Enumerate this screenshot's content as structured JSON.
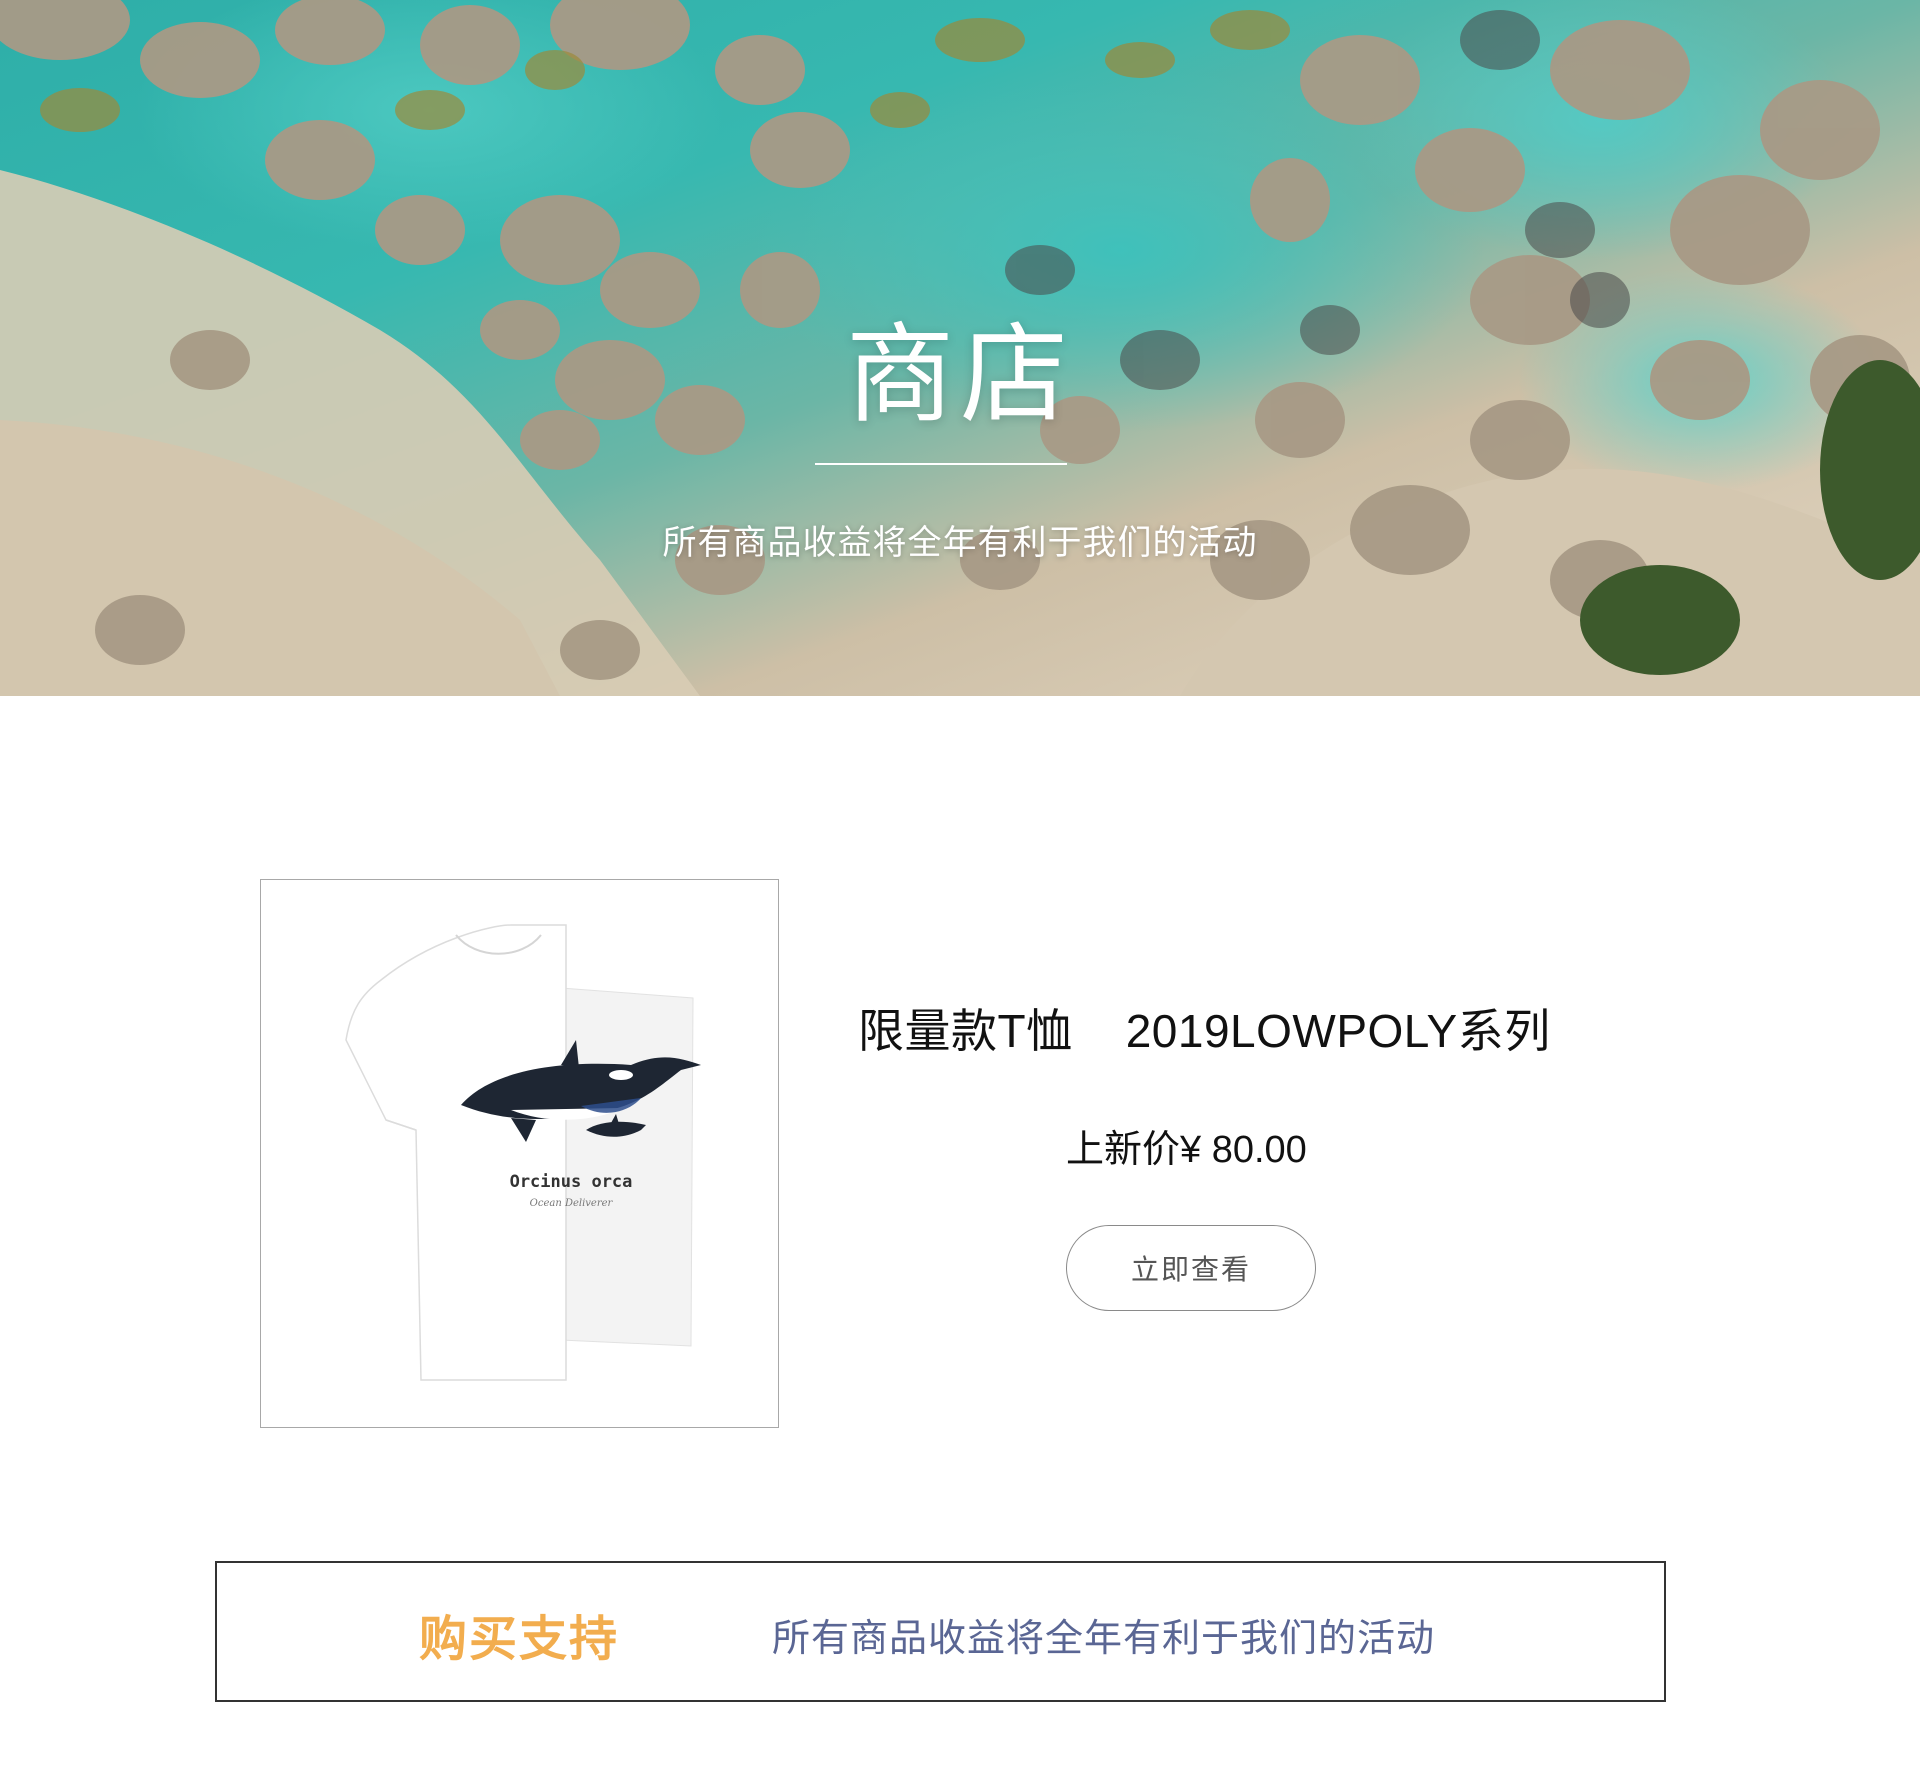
{
  "hero": {
    "title": "商店",
    "subtitle": "所有商品收益将全年有利于我们的活动"
  },
  "product": {
    "name": "限量款T恤    2019LOWPOLY系列",
    "price": "上新价¥ 80.00",
    "view_button_label": "立即查看",
    "shirt_print_title": "Orcinus orca",
    "shirt_print_subtitle": "Ocean Deliverer"
  },
  "support": {
    "heading": "购买支持",
    "text": "所有商品收益将全年有利于我们的活动"
  },
  "colors": {
    "accent_orange": "#f2ad4e",
    "support_text": "#5a6694",
    "border": "#333333"
  }
}
